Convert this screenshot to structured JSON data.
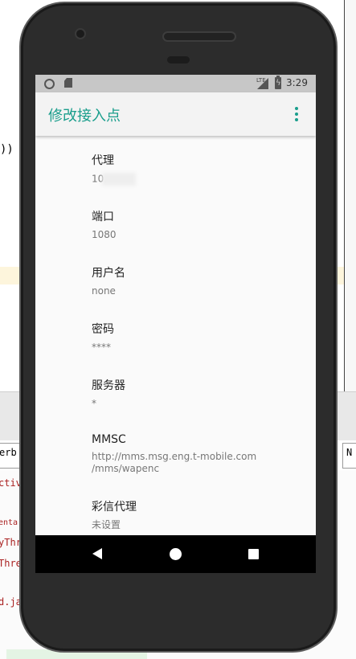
{
  "ide": {
    "code_line_1": "))",
    "combo_left": "erb",
    "combo_right": "N",
    "console": [
      "ctiv",
      "enta",
      "yThr",
      "Thre",
      "d.ja"
    ]
  },
  "status_bar": {
    "network": "LTE",
    "time": "3:29"
  },
  "app_bar": {
    "title": "修改接入点",
    "overflow_icon": "more-vert-icon"
  },
  "preferences": [
    {
      "title": "代理",
      "summary": "10."
    },
    {
      "title": "端口",
      "summary": "1080"
    },
    {
      "title": "用户名",
      "summary": "none"
    },
    {
      "title": "密码",
      "summary": "****"
    },
    {
      "title": "服务器",
      "summary": "*"
    },
    {
      "title": "MMSC",
      "summary": "http://mms.msg.eng.t-mobile.com\n/mms/wapenc"
    },
    {
      "title": "彩信代理",
      "summary": "未设置"
    }
  ],
  "nav_bar": {
    "back_icon": "back-triangle-icon",
    "home_icon": "home-circle-icon",
    "recents_icon": "recents-square-icon"
  }
}
